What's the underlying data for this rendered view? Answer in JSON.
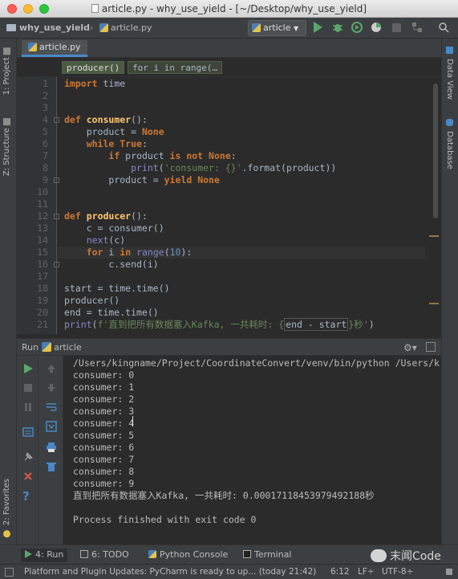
{
  "window": {
    "title": "article.py - why_use_yield - [~/Desktop/why_use_yield]"
  },
  "navbar": {
    "project": "why_use_yield",
    "file": "article.py",
    "run_config": "article"
  },
  "left_strip": {
    "project": "1: Project",
    "structure": "Z: Structure",
    "favorites": "2: Favorites"
  },
  "right_strip": {
    "data_view": "Data View",
    "database": "Database"
  },
  "editor": {
    "tab": "article.py",
    "breadcrumbs": [
      "producer()",
      "for i in range(…"
    ],
    "line_numbers": [
      "1",
      "2",
      "3",
      "4",
      "5",
      "6",
      "7",
      "8",
      "9",
      "10",
      "11",
      "12",
      "13",
      "14",
      "15",
      "16",
      "17",
      "18",
      "19",
      "20",
      "21"
    ],
    "code": {
      "l1": [
        "import",
        " time"
      ],
      "l4": [
        "def",
        " ",
        "consumer",
        "():"
      ],
      "l5": [
        "    product = ",
        "None"
      ],
      "l6": [
        "    ",
        "while",
        " ",
        "True",
        ":"
      ],
      "l7": [
        "        ",
        "if",
        " product ",
        "is not",
        " ",
        "None",
        ":"
      ],
      "l8": [
        "            ",
        "print",
        "(",
        "'consumer: {}'",
        ".format(product))"
      ],
      "l9": [
        "        product = ",
        "yield",
        " ",
        "None"
      ],
      "l12": [
        "def",
        " ",
        "producer",
        "():"
      ],
      "l13": [
        "    c = consumer()"
      ],
      "l14": [
        "    ",
        "next",
        "(c)"
      ],
      "l15": [
        "    ",
        "for",
        " i ",
        "in",
        " ",
        "range",
        "(",
        "10",
        "):"
      ],
      "l16": [
        "        c.send(i)"
      ],
      "l18": [
        "start = time.time()"
      ],
      "l19": [
        "producer()"
      ],
      "l20": [
        "end = time.time()"
      ],
      "l21": [
        "print",
        "(",
        "f'直到把所有数据塞入Kafka, 一共耗时: {",
        "end - start",
        "}秒'",
        ")"
      ]
    }
  },
  "run_panel": {
    "label": "Run",
    "config": "article",
    "output": [
      "/Users/kingname/Project/CoordinateConvert/venv/bin/python /Users/k",
      "consumer: 0",
      "consumer: 1",
      "consumer: 2",
      "consumer: 3",
      "consumer: 4",
      "consumer: 5",
      "consumer: 6",
      "consumer: 7",
      "consumer: 8",
      "consumer: 9",
      "直到把所有数据塞入Kafka, 一共耗时: 0.00017118453979492188秒",
      "",
      "Process finished with exit code 0"
    ]
  },
  "bottom_tabs": {
    "run": "4: Run",
    "todo": "6: TODO",
    "python_console": "Python Console",
    "terminal": "Terminal"
  },
  "status": {
    "message": "Platform and Plugin Updates: PyCharm is ready to up... (today 21:42)",
    "position": "6:12",
    "line_sep": "LF÷",
    "encoding": "UTF-8÷"
  },
  "watermark": "末闻Code",
  "colors": {
    "background": "#2b2b2b",
    "keyword": "#cc7832",
    "function": "#ffc66d",
    "string": "#6a8759",
    "number": "#6897bb",
    "builtin": "#8888c6",
    "run_green": "#59a869"
  }
}
